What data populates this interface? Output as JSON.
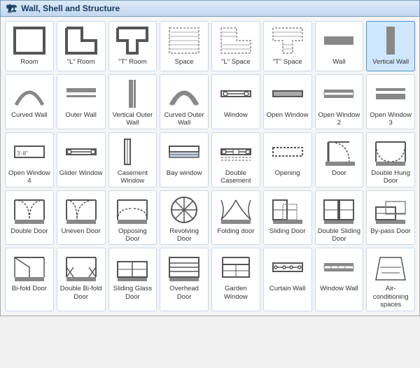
{
  "title": {
    "icon": "wall-icon",
    "label": "Wall, Shell and Structure"
  },
  "items": [
    {
      "id": "room",
      "label": "Room"
    },
    {
      "id": "l-room",
      "label": "\"L\" Room"
    },
    {
      "id": "t-room",
      "label": "\"T\" Room"
    },
    {
      "id": "space",
      "label": "Space"
    },
    {
      "id": "l-space",
      "label": "\"L\" Space"
    },
    {
      "id": "t-space",
      "label": "\"T\" Space"
    },
    {
      "id": "wall",
      "label": "Wall"
    },
    {
      "id": "vertical-wall",
      "label": "Vertical Wall"
    },
    {
      "id": "curved-wall",
      "label": "Curved Wall"
    },
    {
      "id": "outer-wall",
      "label": "Outer Wall"
    },
    {
      "id": "vertical-outer-wall",
      "label": "Vertical Outer Wall"
    },
    {
      "id": "curved-outer-wall",
      "label": "Curved Outer Wall"
    },
    {
      "id": "window",
      "label": "Window"
    },
    {
      "id": "open-window",
      "label": "Open Window"
    },
    {
      "id": "open-window-2",
      "label": "Open Window 2"
    },
    {
      "id": "open-window-3",
      "label": "Open Window 3"
    },
    {
      "id": "open-window-4",
      "label": "Open Window 4"
    },
    {
      "id": "glider-window",
      "label": "Glider Window"
    },
    {
      "id": "casement-window",
      "label": "Casement Window"
    },
    {
      "id": "bay-window",
      "label": "Bay window"
    },
    {
      "id": "double-casement",
      "label": "Double Casement"
    },
    {
      "id": "opening",
      "label": "Opening"
    },
    {
      "id": "door",
      "label": "Door"
    },
    {
      "id": "double-hung-door",
      "label": "Double Hung Door"
    },
    {
      "id": "double-door",
      "label": "Double Door"
    },
    {
      "id": "uneven-door",
      "label": "Uneven Door"
    },
    {
      "id": "opposing-door",
      "label": "Opposing Door"
    },
    {
      "id": "revolving-door",
      "label": "Revolving Door"
    },
    {
      "id": "folding-door",
      "label": "Folding door"
    },
    {
      "id": "sliding-door",
      "label": "Sliding Door"
    },
    {
      "id": "double-sliding-door",
      "label": "Double Sliding Door"
    },
    {
      "id": "by-pass-door",
      "label": "By-pass Door"
    },
    {
      "id": "bi-fold-door",
      "label": "Bi-fold Door"
    },
    {
      "id": "double-bi-fold-door",
      "label": "Double Bi-fold Door"
    },
    {
      "id": "sliding-glass-door",
      "label": "Sliding Glass Door"
    },
    {
      "id": "overhead-door",
      "label": "Overhead Door"
    },
    {
      "id": "garden-window",
      "label": "Garden Window"
    },
    {
      "id": "curtain-wall",
      "label": "Curtain Wall"
    },
    {
      "id": "window-wall",
      "label": "Window Wall"
    },
    {
      "id": "air-conditioning-spaces",
      "label": "Air-conditioning spaces"
    }
  ]
}
